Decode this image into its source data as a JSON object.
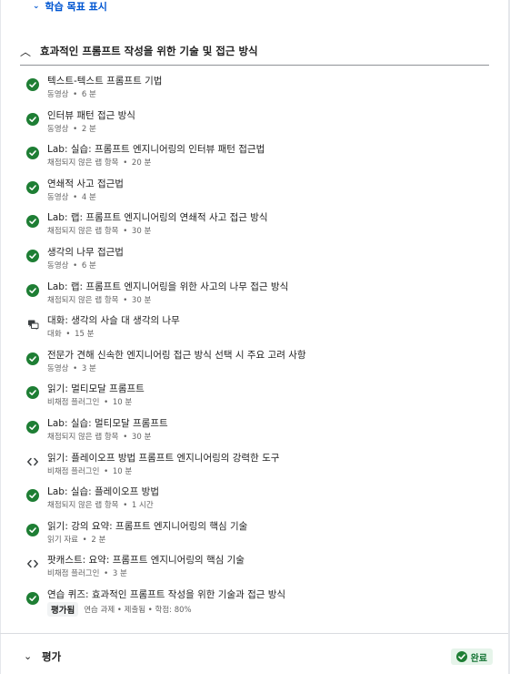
{
  "header": {
    "show_goals_label": "학습 목표 표시",
    "section_title": "효과적인 프롬프트 작성을 위한 기술 및 접근 방식"
  },
  "items": [
    {
      "title": "텍스트-텍스트 프롬프트 기법",
      "type": "동영상",
      "duration": "6 분",
      "icon": "check-circle-icon"
    },
    {
      "title": "인터뷰 패턴 접근 방식",
      "type": "동영상",
      "duration": "2 분",
      "icon": "check-circle-icon"
    },
    {
      "title": "Lab: 실습: 프롬프트 엔지니어링의 인터뷰 패턴 접근법",
      "type": "채점되지 않은 랩 항목",
      "duration": "20 분",
      "icon": "check-circle-icon"
    },
    {
      "title": "연쇄적 사고 접근법",
      "type": "동영상",
      "duration": "4 분",
      "icon": "check-circle-icon"
    },
    {
      "title": "Lab: 랩: 프롬프트 엔지니어링의 연쇄적 사고 접근 방식",
      "type": "채점되지 않은 랩 항목",
      "duration": "30 분",
      "icon": "check-circle-icon"
    },
    {
      "title": "생각의 나무 접근법",
      "type": "동영상",
      "duration": "6 분",
      "icon": "check-circle-icon"
    },
    {
      "title": "Lab: 랩: 프롬프트 엔지니어링을 위한 사고의 나무 접근 방식",
      "type": "채점되지 않은 랩 항목",
      "duration": "30 분",
      "icon": "check-circle-icon"
    },
    {
      "title": "대화: 생각의 사슬 대 생각의 나무",
      "type": "대화",
      "duration": "15 분",
      "icon": "chat-bubbles-icon"
    },
    {
      "title": "전문가 견해 신속한 엔지니어링 접근 방식 선택 시 주요 고려 사항",
      "type": "동영상",
      "duration": "3 분",
      "icon": "check-circle-icon"
    },
    {
      "title": "읽기: 멀티모달 프롬프트",
      "type": "비채점 플러그인",
      "duration": "10 분",
      "icon": "check-circle-icon"
    },
    {
      "title": "Lab: 실습: 멀티모달 프롬프트",
      "type": "채점되지 않은 랩 항목",
      "duration": "30 분",
      "icon": "check-circle-icon"
    },
    {
      "title": "읽기: 플레이오프 방법 프롬프트 엔지니어링의 강력한 도구",
      "type": "비채점 플러그인",
      "duration": "10 분",
      "icon": "code-brackets-icon"
    },
    {
      "title": "Lab: 실습: 플레이오프 방법",
      "type": "채점되지 않은 랩 항목",
      "duration": "1 시간",
      "icon": "check-circle-icon"
    },
    {
      "title": "읽기: 강의 요약: 프롬프트 엔지니어링의 핵심 기술",
      "type": "읽기 자료",
      "duration": "2 분",
      "icon": "check-circle-icon"
    },
    {
      "title": "팟캐스트: 요약: 프롬프트 엔지니어링의 핵심 기술",
      "type": "비채점 플러그인",
      "duration": "3 분",
      "icon": "code-brackets-icon"
    }
  ],
  "quiz": {
    "title": "연습 퀴즈: 효과적인 프롬프트 작성을 위한 기술과 접근 방식",
    "badge": "평가됨",
    "meta": "연습 과제 • 제출됨 • 학점: 80%",
    "icon": "check-circle-icon"
  },
  "module": {
    "title": "평가",
    "status": "완료"
  },
  "colors": {
    "accent_blue": "#0056d2",
    "complete_green": "#1e7e34",
    "badge_green_bg": "#e6f4ea"
  }
}
